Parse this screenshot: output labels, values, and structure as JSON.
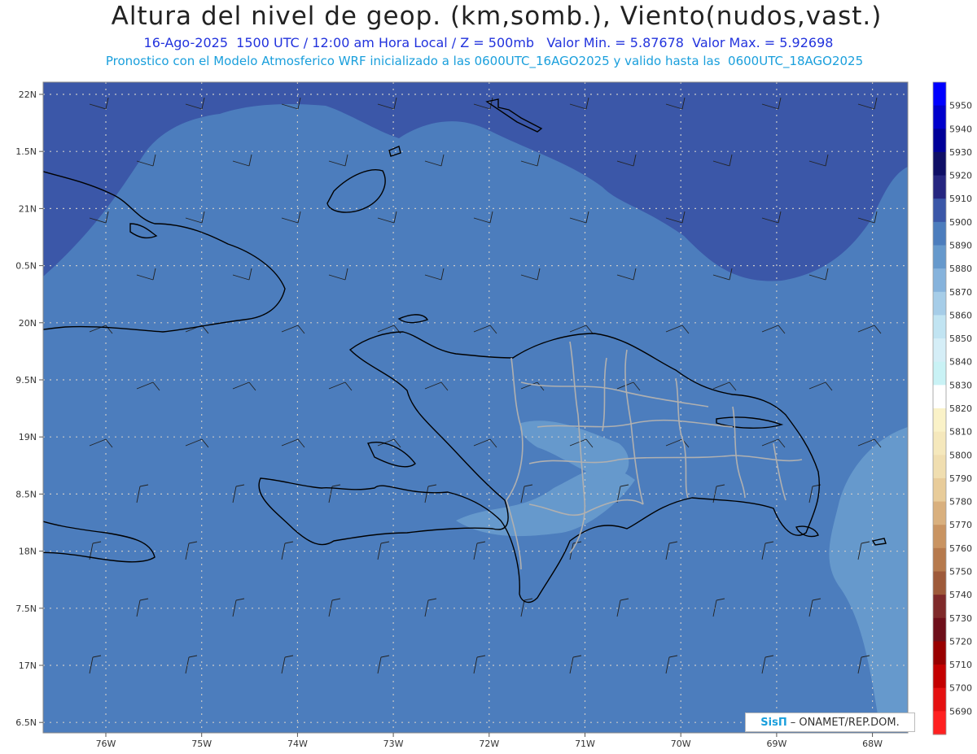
{
  "header": {
    "title": "Altura del nivel de geop. (km,somb.), Viento(nudos,vast.)",
    "line1": "16-Ago-2025  1500 UTC / 12:00 am Hora Local / Z = 500mb   Valor Min. = 5.87678  Valor Max. = 5.92698",
    "line2": "Pronostico con el Modelo Atmosferico WRF inicializado a las 0600UTC_16AGO2025 y valido hasta las  0600UTC_18AGO2025"
  },
  "map": {
    "lat_labels": [
      "22N",
      "1.5N",
      "21N",
      "0.5N",
      "20N",
      "9.5N",
      "19N",
      "8.5N",
      "18N",
      "7.5N",
      "17N",
      "6.5N"
    ],
    "lon_labels": [
      "76W",
      "75W",
      "74W",
      "73W",
      "72W",
      "71W",
      "70W",
      "69W",
      "68W"
    ],
    "shade_colors": {
      "level_5900_5910": "#3b57a8",
      "level_5890_5900": "#4c7dbd",
      "level_5880_5890": "#6699cc",
      "level_5870_5880": "#86b3dc"
    },
    "coast_color": "#000000",
    "province_border_color": "#b0b0b0"
  },
  "colorbar": {
    "labels": [
      "5950",
      "5940",
      "5930",
      "5920",
      "5910",
      "5900",
      "5890",
      "5880",
      "5870",
      "5860",
      "5850",
      "5840",
      "5830",
      "5820",
      "5810",
      "5800",
      "5790",
      "5780",
      "5770",
      "5760",
      "5750",
      "5740",
      "5730",
      "5720",
      "5710",
      "5700",
      "5690"
    ],
    "colors": [
      "#0000ff",
      "#0000cc",
      "#000099",
      "#0f0f66",
      "#262680",
      "#3b57a8",
      "#4c7dbd",
      "#6699cc",
      "#86b3dc",
      "#a6cde8",
      "#c1e4f2",
      "#d5eef7",
      "#c9f2f5",
      "#ffffff",
      "#faf2c8",
      "#f5e8bc",
      "#f0deb0",
      "#e8cc9a",
      "#d9b07e",
      "#c99462",
      "#b67a4d",
      "#9e5a3a",
      "#7f2a2a",
      "#6e0f1a",
      "#990000",
      "#c40000",
      "#e51010",
      "#ff2020"
    ]
  },
  "credit": {
    "brand": "SisΠ",
    "text": "– ONAMET/REP.DOM."
  }
}
